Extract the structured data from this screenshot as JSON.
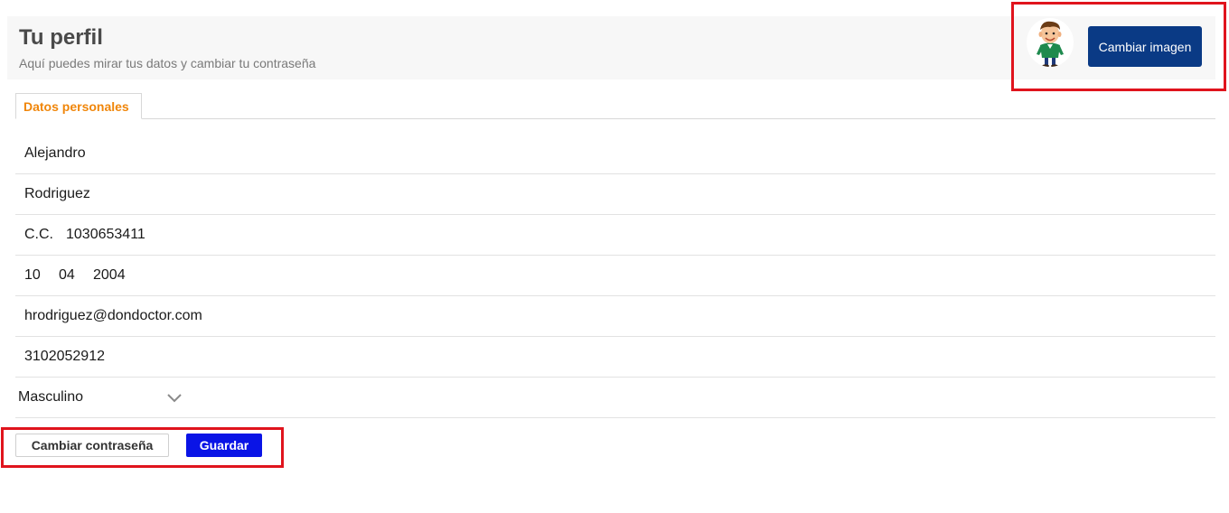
{
  "header": {
    "title": "Tu perfil",
    "subtitle": "Aquí puedes mirar tus datos y cambiar tu contraseña"
  },
  "profile": {
    "avatar_icon": "cartoon-man-avatar-icon",
    "change_image_label": "Cambiar imagen"
  },
  "tabs": [
    {
      "label": "Datos personales",
      "active": true
    }
  ],
  "form": {
    "first_name": "Alejandro",
    "last_name": "Rodriguez",
    "id_type": "C.C.",
    "id_number": "1030653411",
    "birth_day": "10",
    "birth_month": "04",
    "birth_year": "2004",
    "email": "hrodriguez@dondoctor.com",
    "phone": "3102052912",
    "gender": "Masculino"
  },
  "actions": {
    "change_password_label": "Cambiar contraseña",
    "save_label": "Guardar"
  },
  "colors": {
    "accent_tab": "#f0860a",
    "primary_button": "#0a3a85",
    "save_button": "#0a14e6",
    "highlight": "#e0141d"
  }
}
